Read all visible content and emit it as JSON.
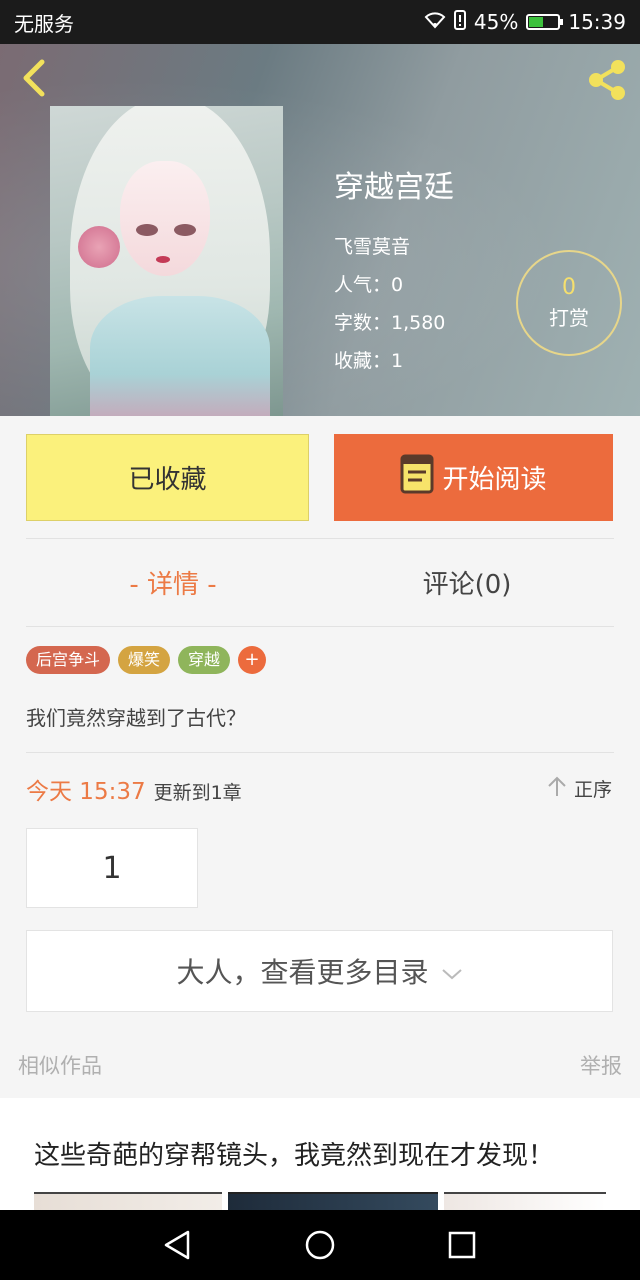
{
  "status_bar": {
    "carrier": "无服务",
    "battery": "45%",
    "time": "15:39",
    "battery_level": 0.45
  },
  "book": {
    "title": "穿越宫廷",
    "author": "飞雪莫音",
    "popularity": "人气：0",
    "word_count": "字数：1,580",
    "favorites": "收藏：1"
  },
  "reward": {
    "count": "0",
    "label": "打赏"
  },
  "actions": {
    "favorited_label": "已收藏",
    "start_reading_label": "开始阅读"
  },
  "tabs": {
    "detail": "- 详情 -",
    "comments": "评论(0)"
  },
  "tags": [
    {
      "label": "后宫争斗",
      "color": "#d4674f"
    },
    {
      "label": "爆笑",
      "color": "#d4a441"
    },
    {
      "label": "穿越",
      "color": "#8fb55b"
    }
  ],
  "tag_add": "+",
  "description": "我们竟然穿越到了古代？",
  "update": {
    "time": "今天 15:37",
    "info": "更新到1章",
    "sort_label": "正序"
  },
  "chapter_number": "1",
  "more_toc_label": "大人，查看更多目录",
  "similar_label": "相似作品",
  "report_label": "举报",
  "ad": {
    "title": "这些奇葩的穿帮镜头，我竟然到现在才发现！"
  },
  "colors": {
    "accent_orange": "#ec6b3d",
    "favorited_yellow": "#fbf17c",
    "reward_gold": "#f5df6d"
  }
}
